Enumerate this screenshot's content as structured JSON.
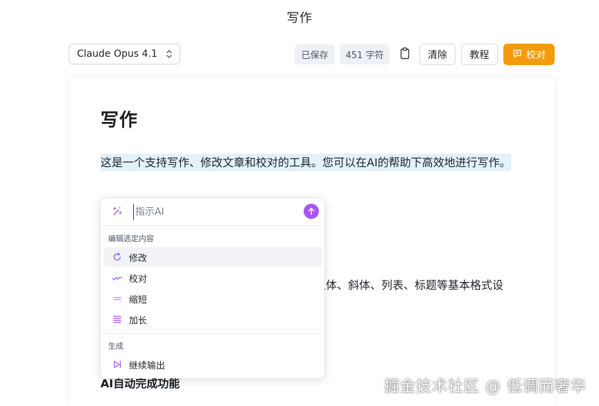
{
  "app": {
    "title": "写作"
  },
  "toolbar": {
    "model_selected": "Claude Opus 4.1",
    "saved_status": "已保存",
    "char_count": "451 字符",
    "clear_label": "清除",
    "tutorial_label": "教程",
    "proofread_label": "校对",
    "accent_color": "#f59b0b"
  },
  "editor": {
    "heading": "写作",
    "paragraph": "这是一个支持写作、修改文章和校对的工具。您可以在AI的帮助下高效地进行写作。",
    "partial_line": "粗体、斜体、列表、标题等基本格式设",
    "subheading": "AI自动完成功能",
    "highlight_color": "#e1f2f9"
  },
  "ai_popup": {
    "placeholder": "指示AI",
    "send_color": "#a855f7",
    "edit_section_label": "编辑选定内容",
    "edit_items": [
      {
        "label": "修改",
        "icon": "refresh-icon"
      },
      {
        "label": "校对",
        "icon": "check-wave-icon"
      },
      {
        "label": "缩短",
        "icon": "shorten-lines-icon"
      },
      {
        "label": "加长",
        "icon": "extend-lines-icon"
      }
    ],
    "generate_section_label": "生成",
    "generate_items": [
      {
        "label": "继续输出",
        "icon": "play-forward-icon"
      }
    ]
  },
  "watermark": "掘金技术社区 @ 低调而奢华"
}
